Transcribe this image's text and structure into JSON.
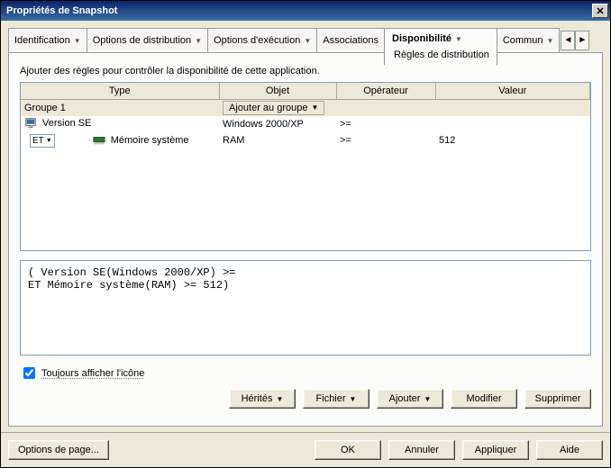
{
  "window": {
    "title": "Propriétés de Snapshot"
  },
  "tabs": {
    "identification": "Identification",
    "distribution": "Options de distribution",
    "execution": "Options d'exécution",
    "associations": "Associations",
    "availability": "Disponibilité",
    "availability_sub": "Règles de distribution",
    "common": "Commun"
  },
  "instructions": "Ajouter des règles pour contrôler la disponibilité de cette application.",
  "grid": {
    "headers": {
      "type": "Type",
      "object": "Objet",
      "operator": "Opérateur",
      "value": "Valeur"
    },
    "group": {
      "label": "Groupe 1",
      "button": "Ajouter au groupe"
    },
    "rows": [
      {
        "logic": "",
        "type": "Version SE",
        "object": "Windows 2000/XP",
        "operator": ">=",
        "value": ""
      },
      {
        "logic": "ET",
        "type": "Mémoire système",
        "object": "RAM",
        "operator": ">=",
        "value": "512"
      }
    ]
  },
  "preview": "( Version SE(Windows 2000/XP) >=\nET Mémoire système(RAM) >= 512)",
  "checkbox": {
    "label": "Toujours afficher l'icône",
    "checked": true
  },
  "panel_buttons": {
    "inherits": "Hérités",
    "file": "Fichier",
    "add": "Ajouter",
    "modify": "Modifier",
    "delete": "Supprimer"
  },
  "footer_buttons": {
    "page_options": "Options de page...",
    "ok": "OK",
    "cancel": "Annuler",
    "apply": "Appliquer",
    "help": "Aide"
  }
}
